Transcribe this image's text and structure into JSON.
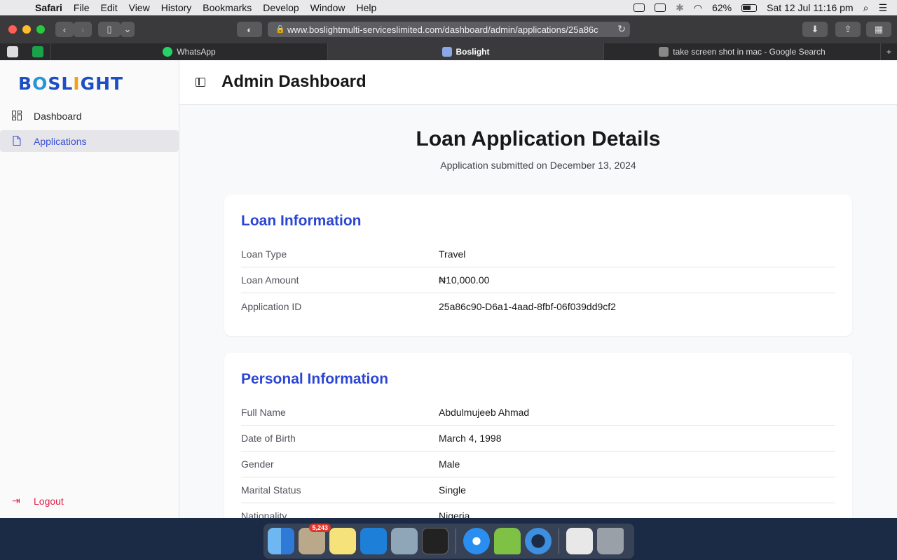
{
  "menubar": {
    "items": [
      "Safari",
      "File",
      "Edit",
      "View",
      "History",
      "Bookmarks",
      "Develop",
      "Window",
      "Help"
    ],
    "battery": "62%",
    "clock": "Sat 12 Jul  11:16 pm"
  },
  "browser": {
    "url": "www.boslightmulti-serviceslimited.com/dashboard/admin/applications/25a86c",
    "tabs": [
      "WhatsApp",
      "Boslight",
      "take screen shot in mac - Google Search"
    ]
  },
  "sidebar": {
    "logo": "BOSLIGHT",
    "items": [
      {
        "label": "Dashboard",
        "icon": "grid-icon"
      },
      {
        "label": "Applications",
        "icon": "document-icon"
      }
    ],
    "logout": "Logout"
  },
  "header": {
    "title": "Admin Dashboard"
  },
  "main": {
    "title": "Loan Application Details",
    "subtitle": "Application submitted on December 13, 2024",
    "loan": {
      "heading": "Loan Information",
      "rows": [
        {
          "label": "Loan Type",
          "value": "Travel"
        },
        {
          "label": "Loan Amount",
          "value": "₦10,000.00"
        },
        {
          "label": "Application ID",
          "value": "25a86c90-D6a1-4aad-8fbf-06f039dd9cf2"
        }
      ]
    },
    "personal": {
      "heading": "Personal Information",
      "rows": [
        {
          "label": "Full Name",
          "value": "Abdulmujeeb Ahmad"
        },
        {
          "label": "Date of Birth",
          "value": "March 4, 1998"
        },
        {
          "label": "Gender",
          "value": "Male"
        },
        {
          "label": "Marital Status",
          "value": "Single"
        },
        {
          "label": "Nationality",
          "value": "Nigeria"
        }
      ]
    }
  },
  "dock": {
    "mail_badge": "5,243"
  },
  "colors": {
    "accent": "#2c46d4",
    "logout": "#e11d48",
    "active_nav_bg": "#e6e6ea"
  }
}
